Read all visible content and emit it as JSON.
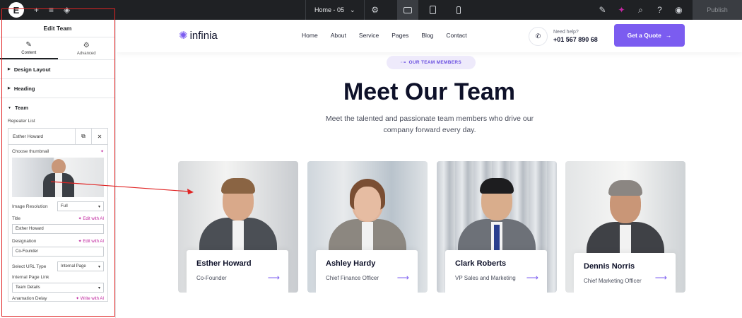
{
  "editor": {
    "logo_glyph": "E",
    "page_label": "Home - 05",
    "publish_label": "Publish",
    "panel_title": "Edit Team",
    "tabs": [
      {
        "label": "Content",
        "icon": "pencil-icon"
      },
      {
        "label": "Advanced",
        "icon": "gear-icon"
      }
    ],
    "sections": [
      "Design Layout",
      "Heading",
      "Team"
    ],
    "repeater_list_label": "Repeater List",
    "repeater_item_title": "Esther Howard",
    "choose_thumbnail_label": "Choose thumbnail",
    "image_resolution_label": "Image Resolution",
    "image_resolution_value": "Full",
    "title_label": "Title",
    "title_value": "Esther Howard",
    "edit_with_ai": "Edit with AI",
    "designation_label": "Designation",
    "designation_value": "Co-Founder",
    "url_type_label": "Select URL Type",
    "url_type_value": "Internal Page",
    "internal_page_label": "Internal Page Link",
    "internal_page_value": "Team Details",
    "animation_delay_label": "Anamation Delay",
    "write_with_ai": "Write with AI"
  },
  "site": {
    "brand": "infinia",
    "nav": [
      "Home",
      "About",
      "Service",
      "Pages",
      "Blog",
      "Contact"
    ],
    "help_label": "Need help?",
    "help_phone": "+01 567 890 68",
    "quote_label": "Get a Quote",
    "badge": "OUR TEAM MEMBERS",
    "heading": "Meet Our Team",
    "subtitle": "Meet the talented and passionate team members who drive our company forward every day.",
    "team": [
      {
        "name": "Esther Howard",
        "role": "Co-Founder"
      },
      {
        "name": "Ashley Hardy",
        "role": "Chief Finance Officer"
      },
      {
        "name": "Clark Roberts",
        "role": "VP Sales and Marketing"
      },
      {
        "name": "Dennis Norris",
        "role": "Chief Marketing Officer"
      }
    ]
  },
  "colors": {
    "accent": "#7b5cf0",
    "editor_dark": "#1f2124",
    "selection": "#e02424",
    "ai": "#c0279f"
  }
}
